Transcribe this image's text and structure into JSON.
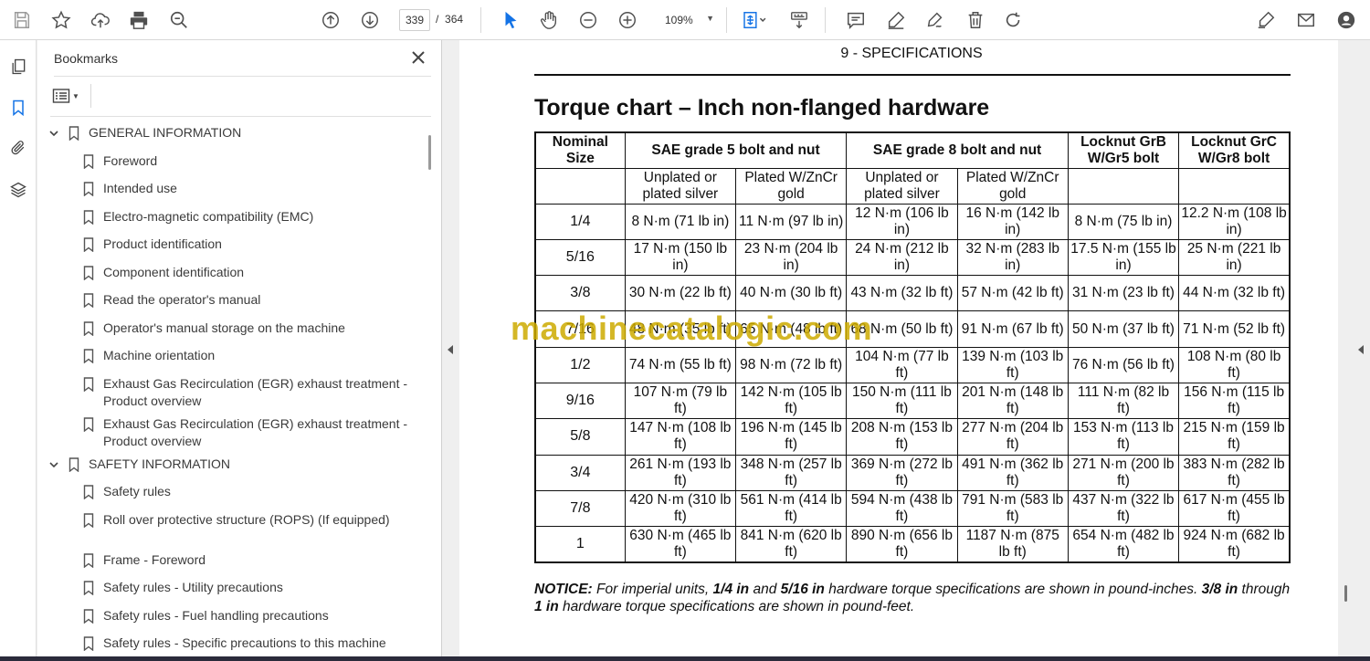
{
  "toolbar": {
    "page_current": "339",
    "page_sep": "/",
    "page_total": "364",
    "zoom": "109%"
  },
  "panel": {
    "title": "Bookmarks",
    "bookmarks": [
      {
        "label": "GENERAL INFORMATION",
        "level": 0,
        "expanded": true
      },
      {
        "label": "Foreword",
        "level": 1
      },
      {
        "label": "Intended use",
        "level": 1
      },
      {
        "label": "Electro-magnetic compatibility (EMC)",
        "level": 1
      },
      {
        "label": "Product identification",
        "level": 1
      },
      {
        "label": "Component identification",
        "level": 1
      },
      {
        "label": "Read the operator's manual",
        "level": 1
      },
      {
        "label": "Operator's manual storage on the machine",
        "level": 1
      },
      {
        "label": "Machine orientation",
        "level": 1
      },
      {
        "label": "Exhaust Gas Recirculation (EGR) exhaust treatment - Product overview",
        "level": 1
      },
      {
        "label": "Exhaust Gas Recirculation (EGR) exhaust treatment - Product overview",
        "level": 1
      },
      {
        "label": "SAFETY INFORMATION",
        "level": 0,
        "expanded": true
      },
      {
        "label": "Safety rules",
        "level": 1
      },
      {
        "label": "Roll over protective structure (ROPS) (If equipped)",
        "level": 1
      },
      {
        "label": "Frame - Foreword",
        "level": 1
      },
      {
        "label": "Safety rules - Utility precautions",
        "level": 1
      },
      {
        "label": "Safety rules - Fuel handling precautions",
        "level": 1
      },
      {
        "label": "Safety rules - Specific precautions to this machine",
        "level": 1
      }
    ]
  },
  "document": {
    "section_header": "9 - SPECIFICATIONS",
    "title": "Torque chart – Inch non-flanged hardware",
    "watermark": "machinecatalogic.com",
    "table": {
      "header1": [
        "Nominal Size",
        "SAE grade 5 bolt and nut",
        "SAE grade 8 bolt and nut",
        "Locknut GrB W/Gr5 bolt",
        "Locknut GrC W/Gr8 bolt"
      ],
      "header2": [
        "Unplated or plated silver",
        "Plated W/ZnCr gold",
        "Unplated or plated silver",
        "Plated W/ZnCr gold"
      ],
      "rows": [
        [
          "1/4",
          "8 N·m (71 lb in)",
          "11 N·m (97 lb in)",
          "12 N·m (106 lb in)",
          "16 N·m (142 lb in)",
          "8 N·m (75 lb in)",
          "12.2 N·m (108 lb in)"
        ],
        [
          "5/16",
          "17 N·m (150 lb in)",
          "23 N·m (204 lb in)",
          "24 N·m (212 lb in)",
          "32 N·m (283 lb in)",
          "17.5 N·m (155 lb in)",
          "25 N·m (221 lb in)"
        ],
        [
          "3/8",
          "30 N·m (22 lb ft)",
          "40 N·m (30 lb ft)",
          "43 N·m (32 lb ft)",
          "57 N·m (42 lb ft)",
          "31 N·m (23 lb ft)",
          "44 N·m (32 lb ft)"
        ],
        [
          "7/16",
          "48 N·m (35 lb ft)",
          "65 N·m (48 lb ft)",
          "68 N·m (50 lb ft)",
          "91 N·m (67 lb ft)",
          "50 N·m (37 lb ft)",
          "71 N·m (52 lb ft)"
        ],
        [
          "1/2",
          "74 N·m (55 lb ft)",
          "98 N·m (72 lb ft)",
          "104 N·m (77 lb ft)",
          "139 N·m (103 lb ft)",
          "76 N·m (56 lb ft)",
          "108 N·m (80 lb ft)"
        ],
        [
          "9/16",
          "107 N·m (79 lb ft)",
          "142 N·m (105 lb ft)",
          "150 N·m (111 lb ft)",
          "201 N·m (148 lb ft)",
          "111 N·m (82 lb ft)",
          "156 N·m (115 lb ft)"
        ],
        [
          "5/8",
          "147 N·m (108 lb ft)",
          "196 N·m (145 lb ft)",
          "208 N·m (153 lb ft)",
          "277 N·m (204 lb ft)",
          "153 N·m (113 lb ft)",
          "215 N·m (159 lb ft)"
        ],
        [
          "3/4",
          "261 N·m (193 lb ft)",
          "348 N·m (257 lb ft)",
          "369 N·m (272 lb ft)",
          "491 N·m (362 lb ft)",
          "271 N·m (200 lb ft)",
          "383 N·m (282 lb ft)"
        ],
        [
          "7/8",
          "420 N·m (310 lb ft)",
          "561 N·m (414 lb ft)",
          "594 N·m (438 lb ft)",
          "791 N·m (583 lb ft)",
          "437 N·m (322 lb ft)",
          "617 N·m (455 lb ft)"
        ],
        [
          "1",
          "630 N·m (465 lb ft)",
          "841 N·m (620 lb ft)",
          "890 N·m (656 lb ft)",
          "1187 N·m (875 lb ft)",
          "654 N·m (482 lb ft)",
          "924 N·m (682 lb ft)"
        ]
      ]
    },
    "notice": {
      "label": "NOTICE:",
      "t1": " For imperial units, ",
      "b1": "1/4 in",
      "t2": " and ",
      "b2": "5/16 in",
      "t3": " hardware torque specifications are shown in pound-inches. ",
      "b3": "3/8 in",
      "t4": " through ",
      "b4": "1 in",
      "t5": " hardware torque specifications are shown in pound-feet."
    }
  }
}
